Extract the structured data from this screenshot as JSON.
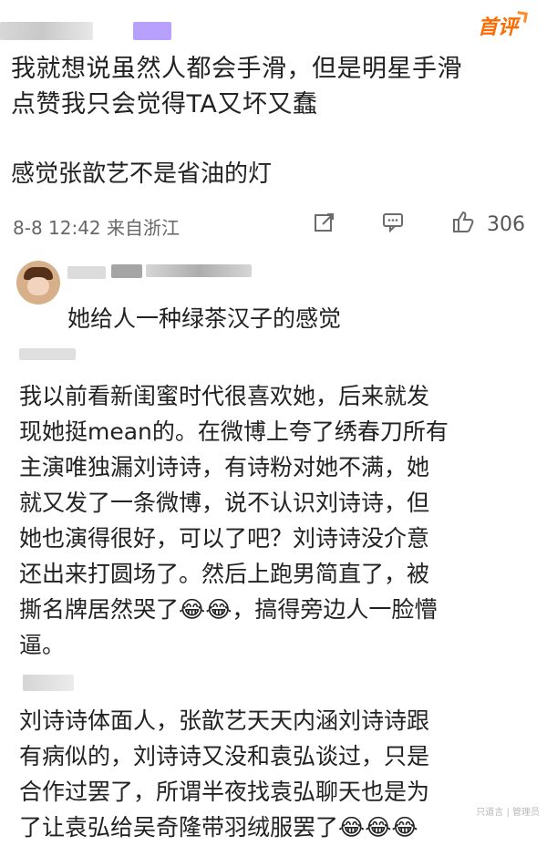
{
  "header": {
    "badge": "首评"
  },
  "post": {
    "body_line1": "我就想说虽然人都会手滑，但是明星手滑",
    "body_line2": "点赞我只会觉得TA又坏又蠢",
    "comment": "感觉张歆艺不是省油的灯",
    "meta_time": "8-8 12:42 来自浙江",
    "likes": "306"
  },
  "reply": {
    "text": "她给人一种绿茶汉子的感觉"
  },
  "comment1": {
    "lines": [
      "我以前看新闺蜜时代很喜欢她，后来就发",
      "现她挺mean的。在微博上夸了绣春刀所有",
      "主演唯独漏刘诗诗，有诗粉对她不满，她",
      "就又发了一条微博，说不认识刘诗诗，但",
      "她也演得很好，可以了吧？刘诗诗没介意",
      "还出来打圆场了。然后上跑男简直了，被",
      "撕名牌居然哭了😂😂，搞得旁边人一脸懵",
      "逼。"
    ]
  },
  "comment2": {
    "lines": [
      "刘诗诗体面人，张歆艺天天内涵刘诗诗跟",
      "有病似的，刘诗诗又没和袁弘谈过，只是",
      "合作过罢了，所谓半夜找袁弘聊天也是为",
      "了让袁弘给吴奇隆带羽绒服罢了😂😂😂"
    ]
  },
  "footer": {
    "watermark": "只道言 | 管理员"
  }
}
